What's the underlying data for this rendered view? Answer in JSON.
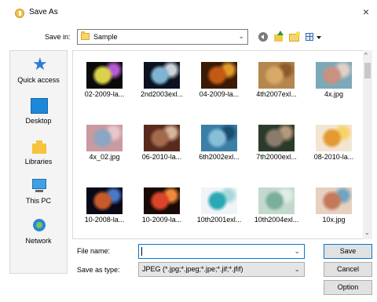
{
  "window": {
    "title": "Save As",
    "close_glyph": "×"
  },
  "toolbar": {
    "save_in_label": "Save in:",
    "save_in_value": "Sample",
    "icons": [
      "back-icon",
      "up-folder-icon",
      "new-folder-icon",
      "view-menu-icon"
    ]
  },
  "places": [
    {
      "label": "Quick access",
      "icon": "quick-access-icon"
    },
    {
      "label": "Desktop",
      "icon": "desktop-icon"
    },
    {
      "label": "Libraries",
      "icon": "libraries-icon"
    },
    {
      "label": "This PC",
      "icon": "this-pc-icon"
    },
    {
      "label": "Network",
      "icon": "network-icon"
    }
  ],
  "files": [
    {
      "name": "02-2009-la...",
      "colors": [
        "#0a0a0a",
        "#d9d24a",
        "#b55ad3"
      ]
    },
    {
      "name": "2nd2003exl...",
      "colors": [
        "#0b1220",
        "#7fb3d1",
        "#ccd4dc"
      ]
    },
    {
      "name": "04-2009-la...",
      "colors": [
        "#3b1a06",
        "#c25a14",
        "#e09a2a"
      ]
    },
    {
      "name": "4th2007exl...",
      "colors": [
        "#b5874e",
        "#d8a864",
        "#8c5a2c"
      ]
    },
    {
      "name": "4x.jpg",
      "colors": [
        "#7da8b8",
        "#c9917f",
        "#e3d0c6"
      ]
    },
    {
      "name": "4x_02.jpg",
      "colors": [
        "#c99aa1",
        "#8aa6c3",
        "#e7c7cc"
      ]
    },
    {
      "name": "06-2010-la...",
      "colors": [
        "#5a2b1c",
        "#a36a4c",
        "#d4b49a"
      ]
    },
    {
      "name": "6th2002exl...",
      "colors": [
        "#3c7fa6",
        "#87bfd8",
        "#1b4d70"
      ]
    },
    {
      "name": "7th2000exl...",
      "colors": [
        "#2c3a2c",
        "#8a7c6a",
        "#b59a7a"
      ]
    },
    {
      "name": "08-2010-la...",
      "colors": [
        "#f2e6d2",
        "#e39a33",
        "#f6d36b"
      ]
    },
    {
      "name": "10-2008-la...",
      "colors": [
        "#0a0816",
        "#c75a2a",
        "#4a78c9"
      ]
    },
    {
      "name": "10-2009-la...",
      "colors": [
        "#1a0a05",
        "#d9442a",
        "#f08a3a"
      ]
    },
    {
      "name": "10th2001exl...",
      "colors": [
        "#f0f4f6",
        "#2aa9b5",
        "#a8d8dc"
      ]
    },
    {
      "name": "10th2004exl...",
      "colors": [
        "#c3d9cd",
        "#7aaf9a",
        "#e0ece6"
      ]
    },
    {
      "name": "10x.jpg",
      "colors": [
        "#e6d0c0",
        "#c47a5a",
        "#6fa4c2"
      ]
    }
  ],
  "form": {
    "file_name_label": "File name:",
    "file_name_value": "",
    "save_as_type_label": "Save as type:",
    "save_as_type_value": "JPEG (*.jpg;*.jpeg;*.jpe;*.jif;*.jfif)"
  },
  "buttons": {
    "save": "Save",
    "cancel": "Cancel",
    "option": "Option"
  }
}
